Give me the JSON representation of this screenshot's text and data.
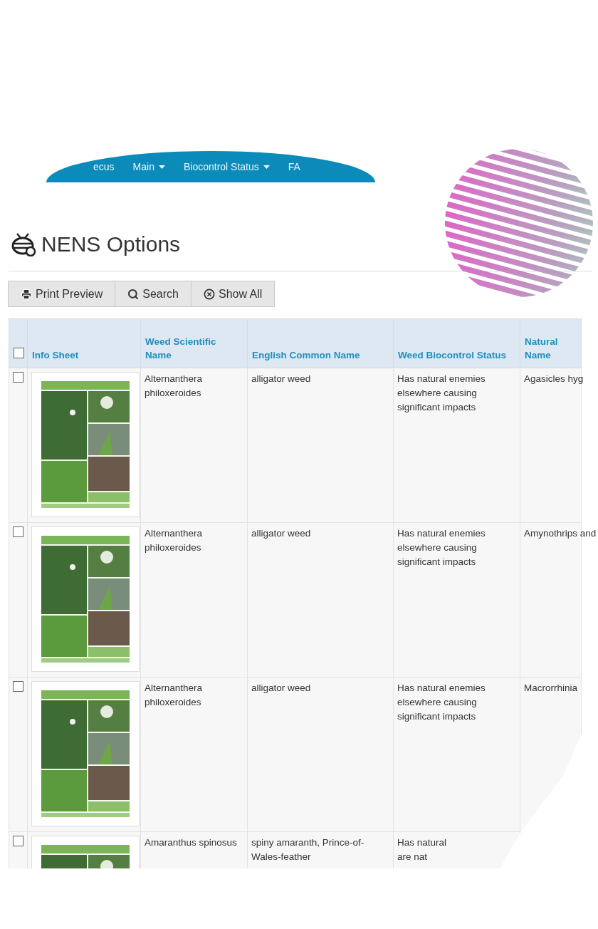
{
  "nav": {
    "items": [
      {
        "label": "ecus",
        "dropdown": false
      },
      {
        "label": "Main",
        "dropdown": true
      },
      {
        "label": "Biocontrol Status",
        "dropdown": true
      },
      {
        "label": "FA",
        "dropdown": false
      }
    ]
  },
  "page": {
    "title": "NENS Options"
  },
  "toolbar": [
    {
      "label": "Print Preview",
      "kind": "print"
    },
    {
      "label": "Search",
      "kind": "search"
    },
    {
      "label": "Show All",
      "kind": "clear"
    }
  ],
  "table": {
    "select_all": {
      "checked": false
    },
    "columns": [
      "Info Sheet",
      "Weed Scientific Name",
      "English Common Name",
      "Weed Biocontrol Status",
      "Natural Name"
    ],
    "rows": [
      {
        "checked": false,
        "cells": [
          {
            "kind": "picture"
          },
          "Alternanthera philoxeroides",
          "alligator weed",
          "Has natural enemies elsewhere causing significant impacts",
          "Agasicles hyg"
        ]
      },
      {
        "checked": false,
        "cells": [
          {
            "kind": "picture"
          },
          "Alternanthera philoxeroides",
          "alligator weed",
          "Has natural enemies elsewhere causing significant impacts",
          "Amynothrips and"
        ]
      },
      {
        "checked": false,
        "cells": [
          {
            "kind": "picture"
          },
          "Alternanthera philoxeroides",
          "alligator weed",
          "Has natural enemies elsewhere causing significant impacts",
          "Macrorrhinia"
        ]
      },
      {
        "checked": false,
        "cells": [
          {
            "kind": "picture"
          },
          "Amaranthus spinosus",
          "spiny amaranth, Prince-of-Wales-feather",
          "Has natural\nare nat",
          ""
        ]
      }
    ]
  }
}
